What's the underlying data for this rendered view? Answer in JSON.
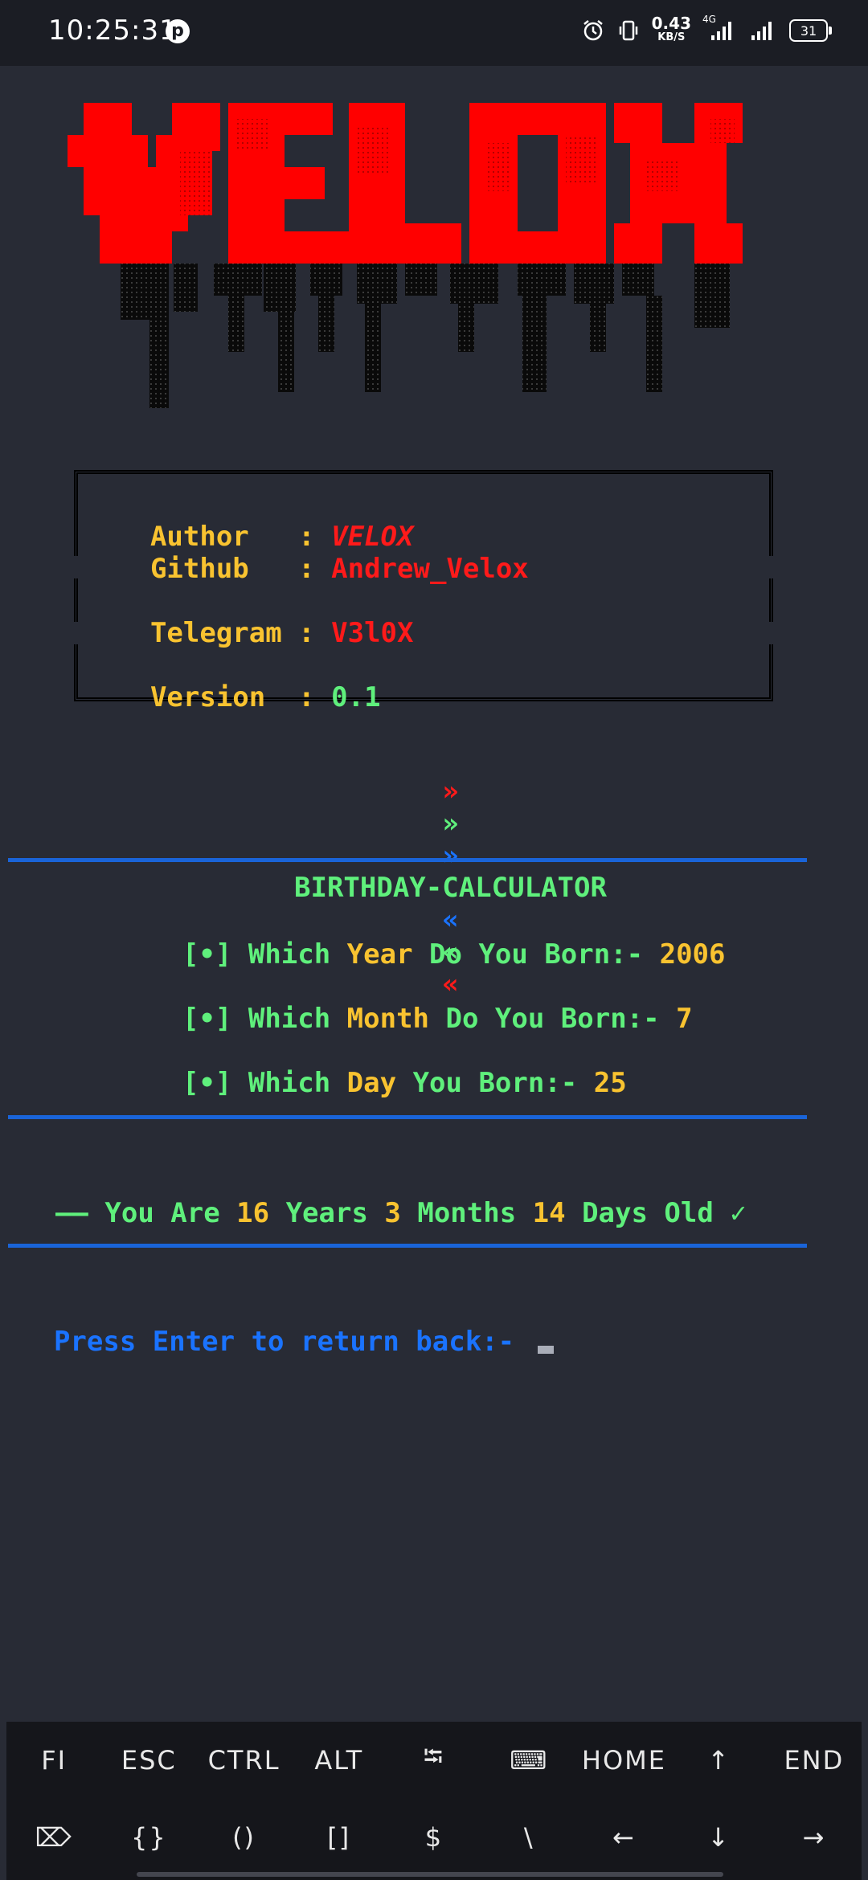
{
  "status_bar": {
    "time": "10:25:31",
    "network_speed_value": "0.43",
    "network_speed_unit": "KB/S",
    "network_type": "4G",
    "battery": "31",
    "icons": [
      "pinterest-icon",
      "alarm-icon",
      "vibrate-icon",
      "signal-icon",
      "signal-icon-2",
      "battery-icon"
    ]
  },
  "logo": {
    "text": "VELOX",
    "color": "#ff0000",
    "drip_color": "#0a0a0a"
  },
  "info": {
    "author_label": "Author   : ",
    "author_value": "VELOX",
    "github_label": "Github   : ",
    "github_value": "Andrew_Velox",
    "telegram_label": "Telegram : ",
    "telegram_value": "V3l0X",
    "version_label": "Version  : ",
    "version_value": "0.1"
  },
  "banner": {
    "left_arrows": [
      "»",
      "»",
      "»"
    ],
    "title": "BIRTHDAY-CALCULATOR",
    "right_arrows": [
      "«",
      "«",
      "«"
    ]
  },
  "questions": [
    {
      "bullet": "[•] ",
      "pre": "Which ",
      "key": "Year",
      "post": " Do You Born:- ",
      "answer": "2006"
    },
    {
      "bullet": "[•] ",
      "pre": "Which ",
      "key": "Month",
      "post": " Do You Born:- ",
      "answer": "7"
    },
    {
      "bullet": "[•] ",
      "pre": "Which ",
      "key": "Day",
      "post": " You Born:- ",
      "answer": "25"
    }
  ],
  "result": {
    "dash": "—— ",
    "p1": "You Are ",
    "years": "16",
    "p2": " Years ",
    "months": "3",
    "p3": " Months ",
    "days": "14",
    "p4": " Days Old ",
    "check": "✓"
  },
  "prompt": "Press Enter to return back:- ",
  "extra_keys": {
    "row1": [
      "FI",
      "ESC",
      "CTRL",
      "ALT",
      "⭾",
      "⌨",
      "HOME",
      "↑",
      "END"
    ],
    "row2": [
      "⌦",
      "{}",
      "()",
      "[]",
      "$",
      "\\",
      "←",
      "↓",
      "→"
    ]
  },
  "colors": {
    "background": "#282b35",
    "accent_blue": "#1a73ff",
    "accent_yellow": "#f9c330",
    "accent_green": "#5ff07c",
    "accent_red": "#ff1a1a"
  }
}
